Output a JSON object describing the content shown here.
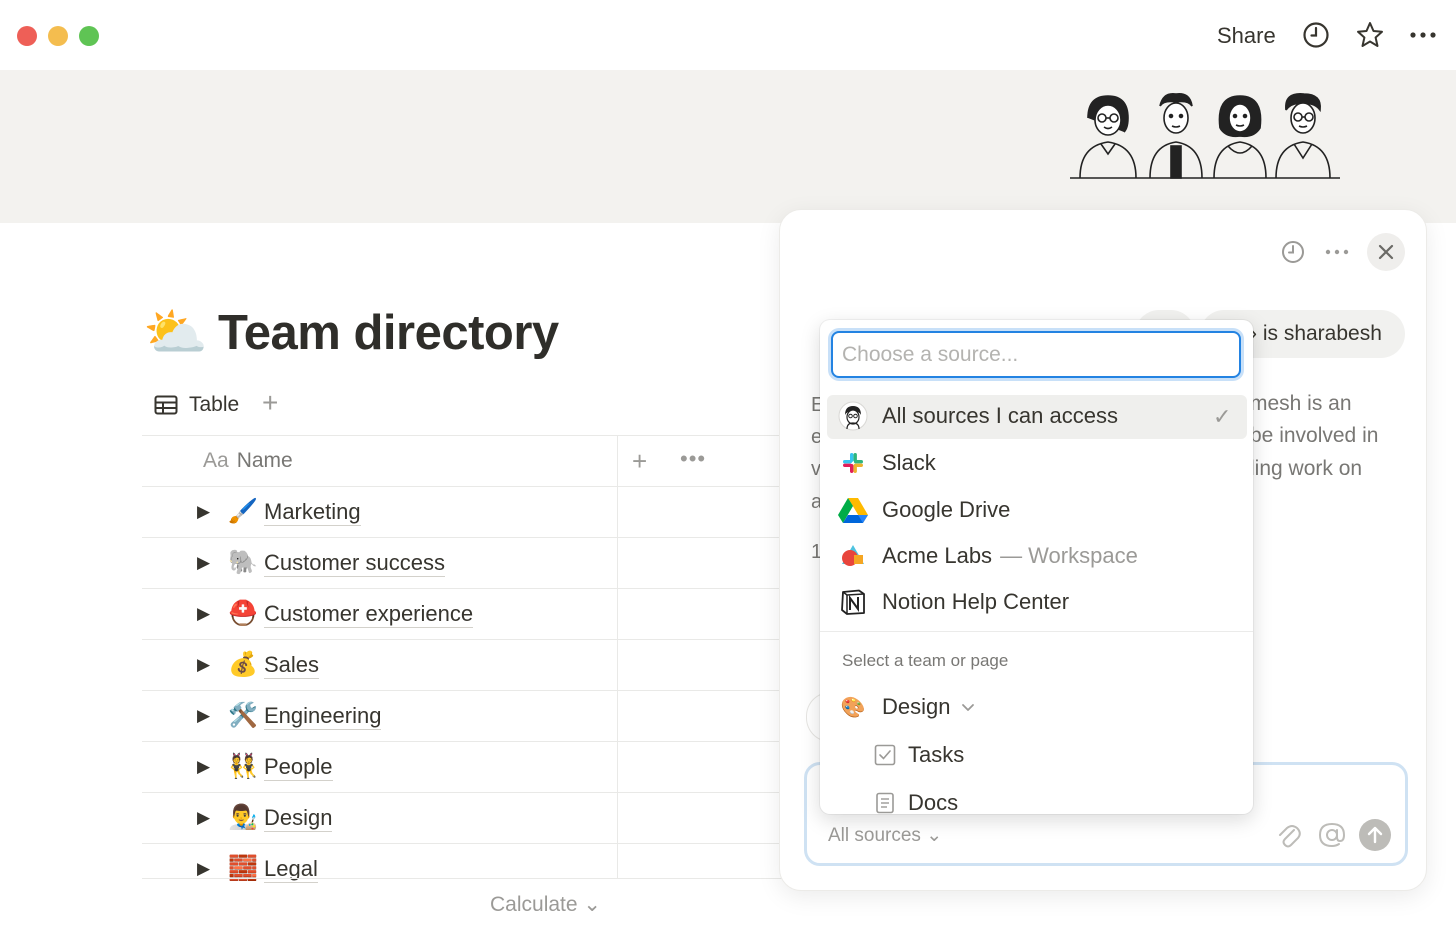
{
  "titlebar": {
    "share_label": "Share",
    "icons": [
      "clock-icon",
      "star-icon",
      "more-icon"
    ],
    "traffic_lights": [
      "#ee5f57",
      "#f4bd4f",
      "#5fc454"
    ]
  },
  "page": {
    "emoji": "⛅",
    "title": "Team directory",
    "view_tab": "Table",
    "view_add": "+"
  },
  "table": {
    "header_prefix": "Aa",
    "header_name": "Name",
    "header_add": "+",
    "header_more": "•••",
    "rows": [
      {
        "emoji": "🖌️",
        "label": "Marketing"
      },
      {
        "emoji": "🐘",
        "label": "Customer success"
      },
      {
        "emoji": "⛑️",
        "label": "Customer experience"
      },
      {
        "emoji": "💰",
        "label": "Sales"
      },
      {
        "emoji": "🛠️",
        "label": "Engineering"
      },
      {
        "emoji": "👯",
        "label": "People"
      },
      {
        "emoji": "👨‍🎨",
        "label": "Design"
      },
      {
        "emoji": "🧱",
        "label": "Legal"
      }
    ],
    "calculate_label": "Calculate ⌄"
  },
  "ai_panel": {
    "question_fragment": "› is sharabesh",
    "answer_fragments": [
      "mesh is an",
      "be involved in",
      "ling work on"
    ],
    "peek_letters": [
      "E",
      "e",
      "v",
      "a",
      "1"
    ],
    "composer_sources": "All sources ⌄"
  },
  "source_menu": {
    "placeholder": "Choose a source...",
    "options": [
      {
        "label": "All sources I can access",
        "suffix": "",
        "icon": "avatar-icon",
        "selected": true
      },
      {
        "label": "Slack",
        "suffix": "",
        "icon": "slack-icon",
        "selected": false
      },
      {
        "label": "Google Drive",
        "suffix": "",
        "icon": "google-drive-icon",
        "selected": false
      },
      {
        "label": "Acme Labs",
        "suffix": "— Workspace",
        "icon": "acme-labs-icon",
        "selected": false
      },
      {
        "label": "Notion Help Center",
        "suffix": "",
        "icon": "notion-icon",
        "selected": false
      }
    ],
    "section_heading": "Select a team or page",
    "team": {
      "label": "Design",
      "emoji": "🎨"
    },
    "pages": [
      {
        "label": "Tasks",
        "icon": "checkbox-icon"
      },
      {
        "label": "Docs",
        "icon": "document-icon"
      }
    ]
  }
}
